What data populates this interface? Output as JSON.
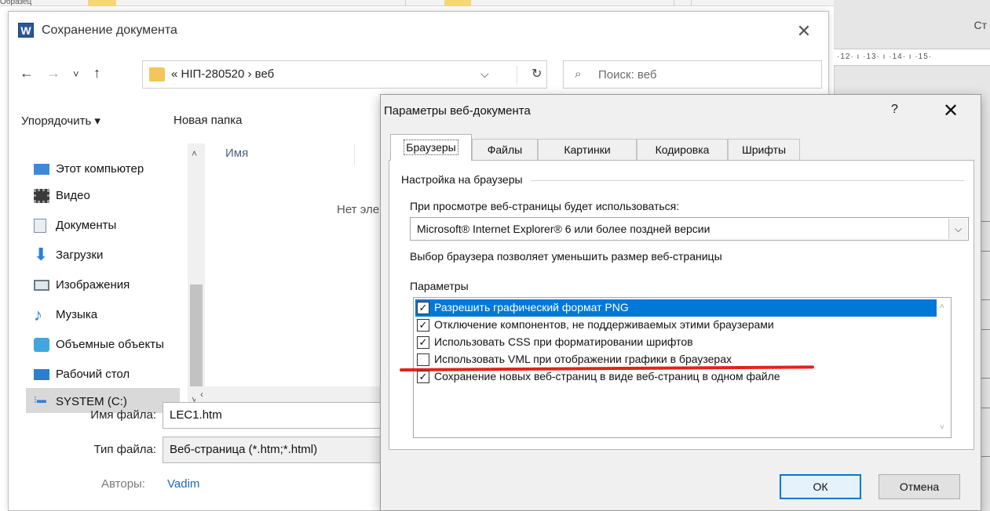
{
  "word": {
    "top_fragment": "Образец",
    "right_label": "Ст",
    "ruler_text": "·12· ı ·13· ı ·14· ı ·15·"
  },
  "save_dialog": {
    "app_icon": "W",
    "title": "Сохранение документа",
    "nav": {
      "back": "←",
      "forward": "→",
      "recent": "˅",
      "up": "↑"
    },
    "address": "« НІП-280520  ›  веб",
    "search_placeholder": "Поиск: веб",
    "toolbar": {
      "organize": "Упорядочить ▾",
      "new_folder": "Новая папка"
    },
    "nav_items": [
      {
        "label": "Этот компьютер",
        "icon": "computer-icon"
      },
      {
        "label": "Видео",
        "icon": "video-icon"
      },
      {
        "label": "Документы",
        "icon": "documents-icon"
      },
      {
        "label": "Загрузки",
        "icon": "downloads-icon"
      },
      {
        "label": "Изображения",
        "icon": "pictures-icon"
      },
      {
        "label": "Музыка",
        "icon": "music-icon"
      },
      {
        "label": "Объемные объекты",
        "icon": "3d-objects-icon"
      },
      {
        "label": "Рабочий стол",
        "icon": "desktop-icon"
      },
      {
        "label": "SYSTEM (C:)",
        "icon": "drive-icon"
      }
    ],
    "column_name": "Имя",
    "empty_text": "Нет элементов",
    "file_name_label": "Имя файла:",
    "file_name_value": "LEC1.htm",
    "file_type_label": "Тип файла:",
    "file_type_value": "Веб-страница (*.htm;*.html)",
    "authors_label": "Авторы:",
    "authors_value": "Vadim"
  },
  "web_options": {
    "title": "Параметры веб-документа",
    "help": "?",
    "close": "✕",
    "tabs": [
      "Браузеры",
      "Файлы",
      "Картинки",
      "Кодировка",
      "Шрифты"
    ],
    "active_tab": "Браузеры",
    "group_browser": "Настройка на браузеры",
    "browser_prompt": "При просмотре веб-страницы будет использоваться:",
    "browser_selected": "Microsoft® Internet Explorer® 6 или более поздней версии",
    "browser_hint": "Выбор браузера позволяет уменьшить размер веб-страницы",
    "group_params": "Параметры",
    "options": [
      {
        "label": "Разрешить графический формат PNG",
        "checked": true,
        "selected": true
      },
      {
        "label": "Отключение компонентов, не поддерживаемых этими браузерами",
        "checked": true,
        "selected": false
      },
      {
        "label": "Использовать CSS при форматировании шрифтов",
        "checked": true,
        "selected": false
      },
      {
        "label": "Использовать VML при отображении графики в браузерах",
        "checked": false,
        "selected": false
      },
      {
        "label": "Сохранение новых веб-страниц в виде веб-страниц в одном файле",
        "checked": true,
        "selected": false
      }
    ],
    "ok": "ОК",
    "cancel": "Отмена",
    "colors": {
      "selection": "#0078d7",
      "annotation_underline": "#e2231a",
      "ok_border": "#0078d7"
    }
  }
}
